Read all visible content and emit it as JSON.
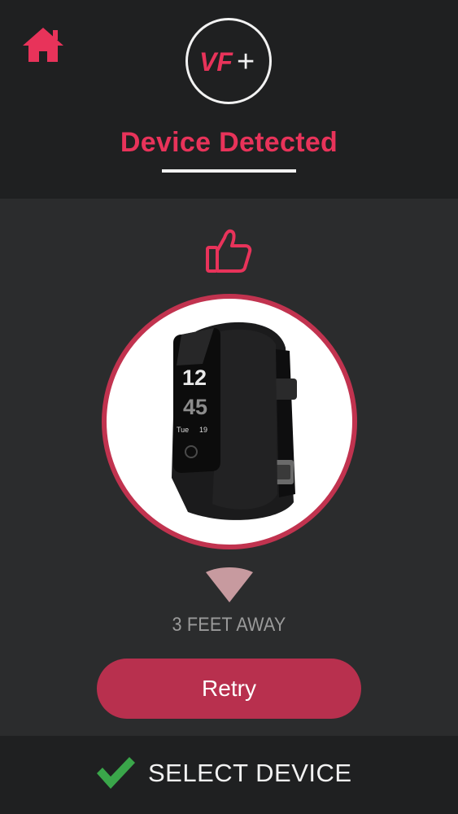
{
  "header": {
    "title": "Device Detected",
    "logo_text": "VF",
    "logo_plus": "+"
  },
  "device": {
    "screen_time_hour": "12",
    "screen_time_minute": "45",
    "screen_day": "Tue",
    "screen_date": "19"
  },
  "status": {
    "distance": "3 FEET AWAY"
  },
  "actions": {
    "retry_label": "Retry",
    "select_label": "SELECT DEVICE"
  },
  "icons": {
    "home": "home-icon",
    "thumb": "thumbs-up-icon",
    "signal": "signal-icon",
    "check": "check-icon"
  },
  "colors": {
    "accent": "#e8335a",
    "button": "#b8304e",
    "check": "#3aa64a",
    "background": "#2b2c2d",
    "header_bg": "#1f2021"
  }
}
